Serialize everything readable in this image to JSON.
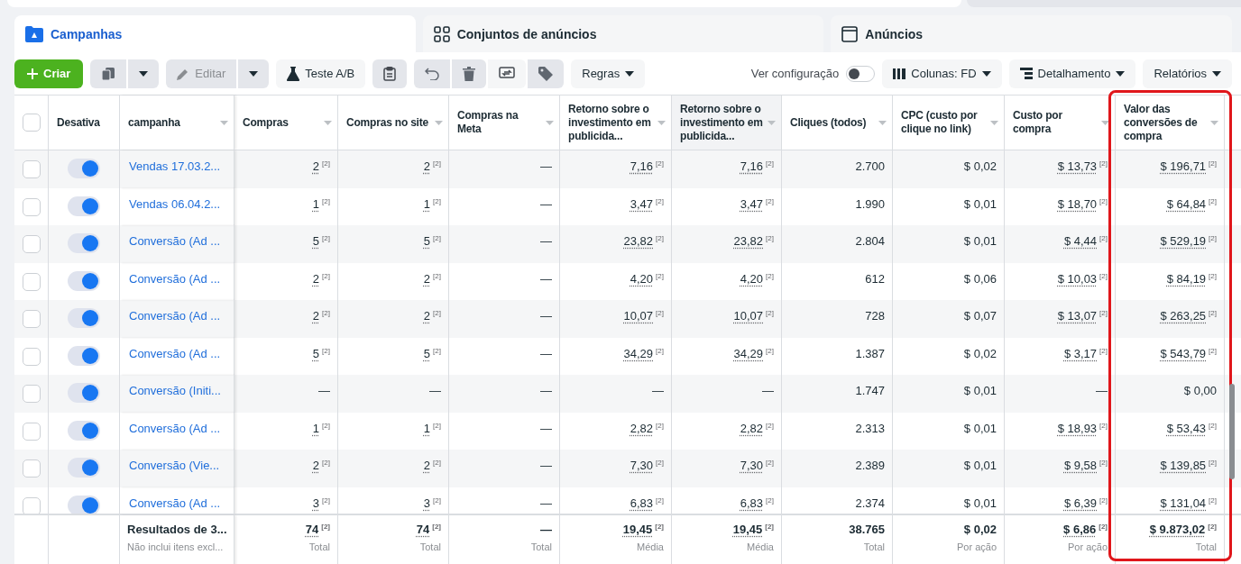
{
  "tabs": [
    {
      "kind": "campaigns",
      "label": "Campanhas",
      "selected": true
    },
    {
      "kind": "adsets",
      "label": "Conjuntos de anúncios",
      "selected": false
    },
    {
      "kind": "ads",
      "label": "Anúncios",
      "selected": false
    }
  ],
  "toolbar": {
    "create": {
      "label": "Criar"
    },
    "edit": {
      "label": "Editar",
      "disabled": true
    },
    "ab_test": {
      "label": "Teste A/B"
    },
    "rules": {
      "label": "Regras"
    },
    "view_settings": {
      "label": "Ver configuração",
      "on": false
    },
    "columns": {
      "label": "Colunas: FD"
    },
    "breakdown": {
      "label": "Detalhamento"
    },
    "reports": {
      "label": "Relatórios"
    }
  },
  "table": {
    "select_all": {
      "checked": false
    },
    "status_column": {
      "label": "Desativa"
    },
    "name_column": {
      "label": "campanha"
    },
    "columns": [
      {
        "label": "Compras",
        "hovered": false,
        "highlighted": false
      },
      {
        "label": "Compras no site",
        "hovered": false,
        "highlighted": false
      },
      {
        "label": "Compras na Meta",
        "hovered": false,
        "highlighted": false
      },
      {
        "label": "Retorno sobre o investimento em publicida...",
        "hovered": false,
        "highlighted": false
      },
      {
        "label": "Retorno sobre o investimento em publicida...",
        "hovered": true,
        "highlighted": false
      },
      {
        "label": "Cliques (todos)",
        "hovered": false,
        "highlighted": false
      },
      {
        "label": "CPC (custo por clique no link)",
        "hovered": false,
        "highlighted": false
      },
      {
        "label": "Custo por compra",
        "hovered": false,
        "highlighted": false
      },
      {
        "label": "Valor das conversões de compra",
        "hovered": false,
        "highlighted": true
      }
    ],
    "rows": [
      {
        "checked": false,
        "on": true,
        "name": "Vendas 17.03.2...",
        "cells": [
          {
            "v": "2",
            "note": "[2]"
          },
          {
            "v": "2",
            "note": "[2]"
          },
          "—",
          {
            "v": "7,16",
            "note": "[2]"
          },
          {
            "v": "7,16",
            "note": "[2]"
          },
          "2.700",
          "$ 0,02",
          {
            "v": "$ 13,73",
            "note": "[2]"
          },
          {
            "v": "$ 196,71",
            "note": "[2]"
          }
        ]
      },
      {
        "checked": false,
        "on": true,
        "name": "Vendas 06.04.2...",
        "cells": [
          {
            "v": "1",
            "note": "[2]"
          },
          {
            "v": "1",
            "note": "[2]"
          },
          "—",
          {
            "v": "3,47",
            "note": "[2]"
          },
          {
            "v": "3,47",
            "note": "[2]"
          },
          "1.990",
          "$ 0,01",
          {
            "v": "$ 18,70",
            "note": "[2]"
          },
          {
            "v": "$ 64,84",
            "note": "[2]"
          }
        ]
      },
      {
        "checked": false,
        "on": true,
        "name": "Conversão (Ad ...",
        "cells": [
          {
            "v": "5",
            "note": "[2]"
          },
          {
            "v": "5",
            "note": "[2]"
          },
          "—",
          {
            "v": "23,82",
            "note": "[2]"
          },
          {
            "v": "23,82",
            "note": "[2]"
          },
          "2.804",
          "$ 0,01",
          {
            "v": "$ 4,44",
            "note": "[2]"
          },
          {
            "v": "$ 529,19",
            "note": "[2]"
          }
        ]
      },
      {
        "checked": false,
        "on": true,
        "name": "Conversão (Ad ...",
        "cells": [
          {
            "v": "2",
            "note": "[2]"
          },
          {
            "v": "2",
            "note": "[2]"
          },
          "—",
          {
            "v": "4,20",
            "note": "[2]"
          },
          {
            "v": "4,20",
            "note": "[2]"
          },
          "612",
          "$ 0,06",
          {
            "v": "$ 10,03",
            "note": "[2]"
          },
          {
            "v": "$ 84,19",
            "note": "[2]"
          }
        ]
      },
      {
        "checked": false,
        "on": true,
        "name": "Conversão (Ad ...",
        "cells": [
          {
            "v": "2",
            "note": "[2]"
          },
          {
            "v": "2",
            "note": "[2]"
          },
          "—",
          {
            "v": "10,07",
            "note": "[2]"
          },
          {
            "v": "10,07",
            "note": "[2]"
          },
          "728",
          "$ 0,07",
          {
            "v": "$ 13,07",
            "note": "[2]"
          },
          {
            "v": "$ 263,25",
            "note": "[2]"
          }
        ]
      },
      {
        "checked": false,
        "on": true,
        "name": "Conversão (Ad ...",
        "cells": [
          {
            "v": "5",
            "note": "[2]"
          },
          {
            "v": "5",
            "note": "[2]"
          },
          "—",
          {
            "v": "34,29",
            "note": "[2]"
          },
          {
            "v": "34,29",
            "note": "[2]"
          },
          "1.387",
          "$ 0,02",
          {
            "v": "$ 3,17",
            "note": "[2]"
          },
          {
            "v": "$ 543,79",
            "note": "[2]"
          }
        ]
      },
      {
        "checked": false,
        "on": true,
        "name": "Conversão (Initi...",
        "cells": [
          "—",
          "—",
          "—",
          "—",
          "—",
          "1.747",
          "$ 0,01",
          "—",
          "$ 0,00"
        ]
      },
      {
        "checked": false,
        "on": true,
        "name": "Conversão (Ad ...",
        "cells": [
          {
            "v": "1",
            "note": "[2]"
          },
          {
            "v": "1",
            "note": "[2]"
          },
          "—",
          {
            "v": "2,82",
            "note": "[2]"
          },
          {
            "v": "2,82",
            "note": "[2]"
          },
          "2.313",
          "$ 0,01",
          {
            "v": "$ 18,93",
            "note": "[2]"
          },
          {
            "v": "$ 53,43",
            "note": "[2]"
          }
        ]
      },
      {
        "checked": false,
        "on": true,
        "name": "Conversão (Vie...",
        "cells": [
          {
            "v": "2",
            "note": "[2]"
          },
          {
            "v": "2",
            "note": "[2]"
          },
          "—",
          {
            "v": "7,30",
            "note": "[2]"
          },
          {
            "v": "7,30",
            "note": "[2]"
          },
          "2.389",
          "$ 0,01",
          {
            "v": "$ 9,58",
            "note": "[2]"
          },
          {
            "v": "$ 139,85",
            "note": "[2]"
          }
        ]
      },
      {
        "checked": false,
        "on": true,
        "name": "Conversão (Ad ...",
        "cells": [
          {
            "v": "3",
            "note": "[2]"
          },
          {
            "v": "3",
            "note": "[2]"
          },
          "—",
          {
            "v": "6,83",
            "note": "[2]"
          },
          {
            "v": "6,83",
            "note": "[2]"
          },
          "2.374",
          "$ 0,01",
          {
            "v": "$ 6,39",
            "note": "[2]"
          },
          {
            "v": "$ 131,04",
            "note": "[2]"
          }
        ]
      }
    ],
    "footer": {
      "name": "Resultados de 3...",
      "subtitle": "Não inclui itens excl...",
      "totals": [
        {
          "v": "74",
          "note": "[2]",
          "label": "Total"
        },
        {
          "v": "74",
          "note": "[2]",
          "label": "Total"
        },
        {
          "v": "—",
          "label": "Total"
        },
        {
          "v": "19,45",
          "note": "[2]",
          "label": "Média"
        },
        {
          "v": "19,45",
          "note": "[2]",
          "label": "Média"
        },
        {
          "v": "38.765",
          "label": "Total"
        },
        {
          "v": "$ 0,02",
          "label": "Por ação"
        },
        {
          "v": "$ 6,86",
          "note": "[2]",
          "label": "Por ação"
        },
        {
          "v": "$ 9.873,02",
          "note": "[2]",
          "label": "Total"
        }
      ]
    }
  }
}
